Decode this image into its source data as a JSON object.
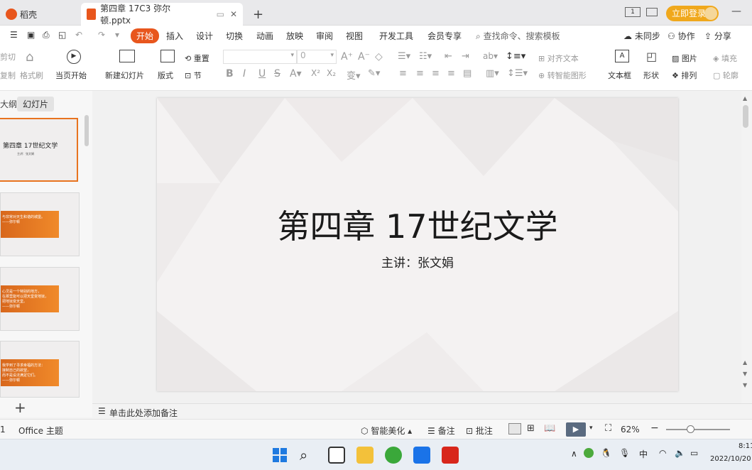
{
  "tabs": {
    "home_label": "稻壳",
    "doc_label": "第四章 17C3 弥尔顿.pptx",
    "new_tab_symbol": "+",
    "page_indicator": "1",
    "login_label": "立即登录"
  },
  "menu": {
    "items": [
      "开始",
      "插入",
      "设计",
      "切换",
      "动画",
      "放映",
      "审阅",
      "视图",
      "开发工具",
      "会员专享"
    ],
    "search_placeholder": "查找命令、搜索模板",
    "sync_label": "未同步",
    "collab_label": "协作",
    "share_label": "分享"
  },
  "ribbon": {
    "cut": "剪切",
    "copy": "复制",
    "format_painter": "格式刷",
    "play_from_current": "当页开始",
    "new_slide": "新建幻灯片",
    "layout": "版式",
    "reset": "重置",
    "section": "节",
    "font_name": "",
    "font_size": "0",
    "bold": "B",
    "italic": "I",
    "underline": "U",
    "strike": "S",
    "superscript": "X²",
    "subscript": "X₂",
    "align_text": "对齐文本",
    "convert_smartart": "转智能图形",
    "textbox": "文本框",
    "shape": "形状",
    "picture": "图片",
    "arrange": "排列",
    "fill": "填充",
    "outline": "轮廓"
  },
  "left_panel": {
    "tab_outline": "大纲",
    "tab_slides": "幻灯片",
    "add_symbol": "+",
    "thumbs": [
      {
        "title": "第四章 17世纪文学",
        "sub": "主讲：张文娟"
      },
      {
        "text": "与非常对天生和谐的城堡。\n——弥尔顿"
      },
      {
        "text": "心灵是一个特别的地方，\n在那里能可以把天堂变地狱，\n把地狱变天堂。\n——弥尔顿"
      },
      {
        "text": "我学到了寻求幸福的方法：\n接制自己的欲望，\n而不是设法满足它们。\n——弥尔顿"
      }
    ]
  },
  "slide": {
    "title": "第四章 17世纪文学",
    "subtitle": "主讲：张文娟"
  },
  "notes_placeholder": "单击此处添加备注",
  "status": {
    "slide_index": "1",
    "theme": "Office 主题",
    "beautify": "智能美化",
    "notes": "备注",
    "comments": "批注",
    "zoom": "62%"
  },
  "taskbar": {
    "ime": "中",
    "time": "8:11",
    "date": "2022/10/20"
  },
  "colors": {
    "accent": "#e8561d",
    "login": "#f0a81c",
    "thumb_orange": "#e8731f"
  }
}
